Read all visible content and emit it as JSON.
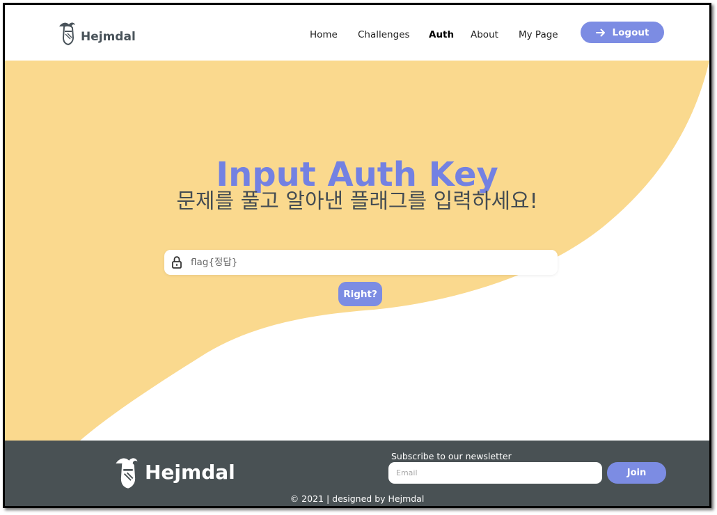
{
  "brand": {
    "name": "Hejmdal",
    "icon": "knight-helmet-icon"
  },
  "nav": {
    "items": [
      "Home",
      "Challenges",
      "Auth",
      "About",
      "My Page"
    ],
    "active": "Auth",
    "logout_label": "Logout",
    "logout_icon": "arrow-right-icon"
  },
  "hero": {
    "title": "Input Auth Key",
    "subtitle": "문제를 풀고 알아낸 플래그를 입력하세요!",
    "input_placeholder": "flag{정답}",
    "input_icon": "lock-icon",
    "submit_label": "Right?"
  },
  "footer": {
    "brand_name": "Hejmdal",
    "newsletter_label": "Subscribe to our newsletter",
    "email_placeholder": "Email",
    "join_label": "Join",
    "copyright": "© 2021 | designed by Hejmdal"
  },
  "colors": {
    "accent": "#7c8ce3",
    "title": "#7381e2",
    "hero_wave": "#fad98e",
    "footer_bg": "#495154",
    "subtitle_text": "#444c52"
  }
}
